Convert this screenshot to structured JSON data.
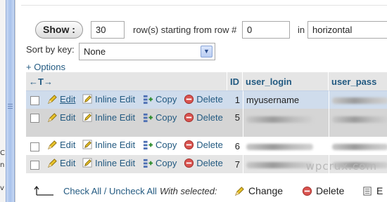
{
  "left_frame": {
    "glyphs": [
      "C",
      "n",
      "",
      "v"
    ]
  },
  "show": {
    "button_label": "Show :",
    "rows_value": "30",
    "rows_label": "row(s) starting from row #",
    "start_value": "0",
    "in_label": "in",
    "mode_value": "horizontal"
  },
  "sort": {
    "label": "Sort by key:",
    "selected": "None"
  },
  "options_label": "+ Options",
  "table": {
    "headers": {
      "arrows": "←T→",
      "id": "ID",
      "login": "user_login",
      "pass": "user_pass"
    },
    "actions": {
      "edit": "Edit",
      "inline_edit": "Inline Edit",
      "copy": "Copy",
      "delete": "Delete"
    },
    "rows": [
      {
        "id": "1",
        "login": "myusername"
      },
      {
        "id": "5",
        "login": ""
      },
      {
        "id": "6",
        "login": ""
      },
      {
        "id": "7",
        "login": ""
      }
    ]
  },
  "footer": {
    "check_all": "Check All / Uncheck All",
    "with_selected": "With selected:",
    "change": "Change",
    "delete": "Delete",
    "export": "E"
  },
  "watermark": "wpcrux.com",
  "colors": {
    "link": "#235a81",
    "header_bg": "#e5e5e5",
    "highlight": "#cfdcec"
  }
}
